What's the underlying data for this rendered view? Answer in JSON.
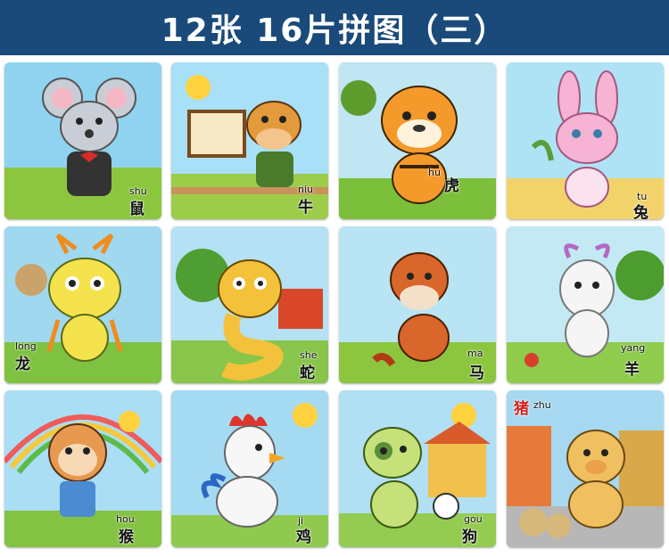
{
  "banner": {
    "title": "12张 16片拼图（三）"
  },
  "puzzles": [
    {
      "animal_icon": "mouse-icon",
      "pinyin": "shu",
      "hanzi": "鼠",
      "bg": "#8fd3f0",
      "ground": "#8cc63f",
      "body": "#c9ced6"
    },
    {
      "animal_icon": "ox-icon",
      "pinyin": "niu",
      "hanzi": "牛",
      "bg": "#a7e0f7",
      "ground": "#9ccc4a",
      "body": "#e39a3b"
    },
    {
      "animal_icon": "tiger-icon",
      "pinyin": "hu",
      "hanzi": "虎",
      "bg": "#bfe6f2",
      "ground": "#7cbf3a",
      "body": "#f39a2b"
    },
    {
      "animal_icon": "rabbit-icon",
      "pinyin": "tu",
      "hanzi": "兔",
      "bg": "#aee3f5",
      "ground": "#f2d36a",
      "body": "#f6b3d4"
    },
    {
      "animal_icon": "dragon-icon",
      "pinyin": "long",
      "hanzi": "龙",
      "bg": "#9fd8ef",
      "ground": "#7fc242",
      "body": "#f4e34c"
    },
    {
      "animal_icon": "snake-icon",
      "pinyin": "she",
      "hanzi": "蛇",
      "bg": "#b4e1f4",
      "ground": "#89c54a",
      "body": "#f4c23a"
    },
    {
      "animal_icon": "horse-icon",
      "pinyin": "ma",
      "hanzi": "马",
      "bg": "#b9e4f4",
      "ground": "#8cc63f",
      "body": "#d9662a"
    },
    {
      "animal_icon": "goat-icon",
      "pinyin": "yang",
      "hanzi": "羊",
      "bg": "#c3e9f5",
      "ground": "#8fcb4c",
      "body": "#f5f5f5"
    },
    {
      "animal_icon": "monkey-icon",
      "pinyin": "hou",
      "hanzi": "猴",
      "bg": "#a9def4",
      "ground": "#84c243",
      "body": "#e79a4f"
    },
    {
      "animal_icon": "rooster-icon",
      "pinyin": "ji",
      "hanzi": "鸡",
      "bg": "#a5dbf2",
      "ground": "#8fc94e",
      "body": "#f7f7f7"
    },
    {
      "animal_icon": "dog-icon",
      "pinyin": "gou",
      "hanzi": "狗",
      "bg": "#b1dff3",
      "ground": "#94cc52",
      "body": "#c6e07a"
    },
    {
      "animal_icon": "pig-icon",
      "pinyin": "zhu",
      "hanzi": "猪",
      "bg": "#a6d9f1",
      "ground": "#b7b7b7",
      "body": "#f0c060"
    }
  ]
}
